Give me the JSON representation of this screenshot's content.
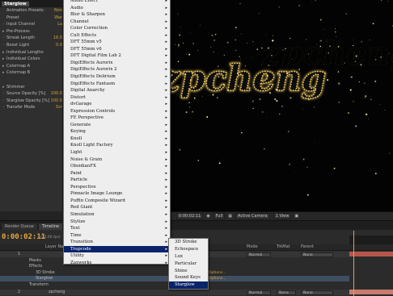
{
  "effect_controls": {
    "effect_name": "Starglow",
    "rows": [
      {
        "label": "Animation Presets:",
        "value": "Non",
        "twirl": ""
      },
      {
        "label": "Preset",
        "value": "War",
        "twirl": ""
      },
      {
        "label": "Input Channel",
        "value": "Lu",
        "twirl": "◦"
      },
      {
        "label": "Pre-Process",
        "value": "",
        "twirl": "▸"
      },
      {
        "label": "Streak Length",
        "value": "16.0",
        "twirl": "◦"
      },
      {
        "label": "Boost Light",
        "value": "0.0",
        "twirl": "◦"
      },
      {
        "label": "Individual Lengths",
        "value": "",
        "twirl": "▸"
      },
      {
        "label": "Individual Colors",
        "value": "",
        "twirl": "▸"
      },
      {
        "label": "Colormap A",
        "value": "",
        "twirl": "▸"
      },
      {
        "label": "Colormap B",
        "value": "",
        "twirl": "▸"
      },
      {
        "label": "",
        "value": "",
        "twirl": ""
      },
      {
        "label": "Shimmer",
        "value": "",
        "twirl": "▸"
      },
      {
        "label": "Source Opacity [%]",
        "value": "100.0",
        "twirl": "◦"
      },
      {
        "label": "Starglow Opacity [%]",
        "value": "100.0",
        "twirl": "◦"
      },
      {
        "label": "Transfer Mode",
        "value": "Scr",
        "twirl": "◦"
      }
    ]
  },
  "composition": {
    "text": "zpcheng",
    "colors": {
      "glow": "#ffd86a",
      "text_fill": "#0a0a0a",
      "sparkle": "#fff2b0"
    }
  },
  "viewer_toolbar": {
    "timecode": "0:00:02:11",
    "resolution": "Full",
    "camera": "Active Camera",
    "views": "1 View"
  },
  "timeline": {
    "tabs": [
      "Render Queue",
      "Timeline"
    ],
    "timecode": "0:00:02:11",
    "fps": "(25.00 fps)",
    "columns": {
      "layer_name": "Layer Name",
      "mode": "Mode",
      "trkmat": "TrkMat",
      "parent": "Parent"
    },
    "rows": [
      {
        "kind": "layer",
        "num": "1",
        "name": "",
        "mode": "Normal",
        "trk": "",
        "parent": "None"
      },
      {
        "kind": "group",
        "name": "Masks"
      },
      {
        "kind": "group",
        "name": "Effects"
      },
      {
        "kind": "effect",
        "name": "3D Stroke",
        "opt": "Options..."
      },
      {
        "kind": "effect_sel",
        "name": "Starglow",
        "opt": "Options..."
      },
      {
        "kind": "group",
        "name": "Transform"
      },
      {
        "kind": "layer",
        "num": "2",
        "name": "zpcheng",
        "mode": "Normal",
        "trk": "None",
        "parent": "None"
      }
    ]
  },
  "effect_menu": {
    "items": [
      {
        "label": "Audio Effect",
        "arrow": true
      },
      {
        "label": "Audio",
        "arrow": true
      },
      {
        "label": "Blur & Sharpen",
        "arrow": true
      },
      {
        "label": "Channel",
        "arrow": true
      },
      {
        "label": "Color Correction",
        "arrow": true
      },
      {
        "label": "Cult Effects",
        "arrow": true
      },
      {
        "label": "DFT 55mm v5",
        "arrow": true
      },
      {
        "label": "DFT 55mm v6",
        "arrow": true
      },
      {
        "label": "DFT Digital Film Lab 2",
        "arrow": true
      },
      {
        "label": "DigiEffects Aurorix",
        "arrow": true
      },
      {
        "label": "DigiEffects Aurorix 2",
        "arrow": true
      },
      {
        "label": "DigiEffects Delirium",
        "arrow": true
      },
      {
        "label": "DigiEffects Fantasm",
        "arrow": true
      },
      {
        "label": "Digital Anarchy",
        "arrow": true
      },
      {
        "label": "Distort",
        "arrow": true
      },
      {
        "label": "dvGarage",
        "arrow": true
      },
      {
        "label": "Expression Controls",
        "arrow": true
      },
      {
        "label": "FE Perspective",
        "arrow": true
      },
      {
        "label": "Generate",
        "arrow": true
      },
      {
        "label": "Keying",
        "arrow": true
      },
      {
        "label": "Knoll",
        "arrow": true
      },
      {
        "label": "Knoll Light Factory",
        "arrow": true
      },
      {
        "label": "Light",
        "arrow": true
      },
      {
        "label": "Noise & Grain",
        "arrow": true
      },
      {
        "label": "ObsidianFX",
        "arrow": true
      },
      {
        "label": "Paint",
        "arrow": true
      },
      {
        "label": "Particle",
        "arrow": true
      },
      {
        "label": "Perspective",
        "arrow": true
      },
      {
        "label": "Pinnacle Image Lounge",
        "arrow": true
      },
      {
        "label": "Puffin Composite Wizard",
        "arrow": true
      },
      {
        "label": "Red Giant",
        "arrow": true
      },
      {
        "label": "Simulation",
        "arrow": true
      },
      {
        "label": "Stylize",
        "arrow": true
      },
      {
        "label": "Text",
        "arrow": true
      },
      {
        "label": "Time",
        "arrow": true
      },
      {
        "label": "Transition",
        "arrow": true
      },
      {
        "label": "Trapcode",
        "arrow": true,
        "highlight": true
      },
      {
        "label": "Utility",
        "arrow": true
      },
      {
        "label": "Zaxwerks",
        "arrow": true
      }
    ]
  },
  "trapcode_submenu": {
    "items": [
      {
        "label": "3D Stroke"
      },
      {
        "label": "Echospace"
      },
      {
        "label": "Lux"
      },
      {
        "label": "Particular"
      },
      {
        "label": "Shine"
      },
      {
        "label": "Sound Keys"
      },
      {
        "label": "Starglow",
        "highlight": true
      }
    ]
  }
}
